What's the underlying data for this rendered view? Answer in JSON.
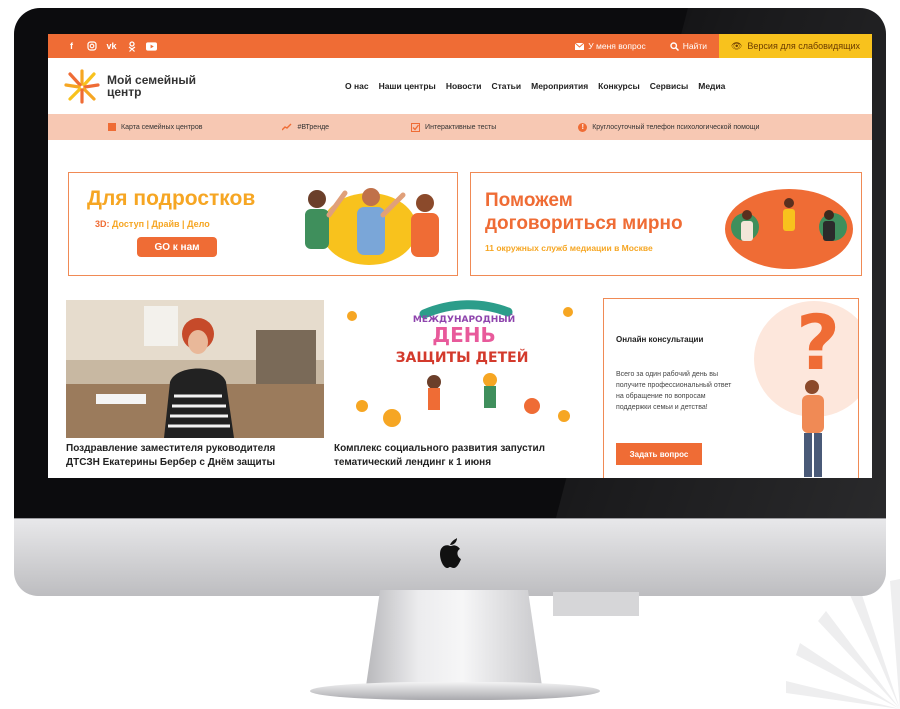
{
  "topbar": {
    "social_icons": [
      "facebook-icon",
      "instagram-icon",
      "vk-icon",
      "odnoklassniki-icon",
      "youtube-icon"
    ],
    "question_label": "У меня вопрос",
    "search_label": "Найти",
    "accessible_label": "Версия для слабовидящих"
  },
  "logo": {
    "line1": "Мой семейный",
    "line2": "центр"
  },
  "nav": {
    "items": [
      "О нас",
      "Наши центры",
      "Новости",
      "Статьи",
      "Мероприятия",
      "Конкурсы",
      "Сервисы",
      "Медиа"
    ]
  },
  "subbar": {
    "items": [
      {
        "label": "Карта семейных центров",
        "icon": "map-icon"
      },
      {
        "label": "#ВТренде",
        "icon": "trend-icon"
      },
      {
        "label": "Интерактивные тесты",
        "icon": "checkbox-icon"
      },
      {
        "label": "Круглосуточный телефон психологической помощи",
        "icon": "info-icon"
      }
    ]
  },
  "banner_teens": {
    "title": "Для подростков",
    "prefix": "3D:",
    "tags": [
      "Доступ",
      "Драйв",
      "Дело"
    ],
    "button": "GO к нам"
  },
  "banner_mediation": {
    "title_line1": "Поможем",
    "title_line2": "договориться мирно",
    "subtitle": "11 окружных служб медиации в Москве"
  },
  "news": [
    {
      "title_line1": "Поздравление заместителя руководителя",
      "title_line2": "ДТСЗН Екатерины Бербер с Днём защиты"
    },
    {
      "title_line1": "Комплекс социального развития запустил",
      "title_line2": "тематический лендинг к 1 июня"
    }
  ],
  "children_day_art": {
    "line1": "МЕЖДУНАРОДНЫЙ",
    "line2": "ДЕНЬ",
    "line3": "ЗАЩИТЫ ДЕТЕЙ"
  },
  "consult": {
    "title": "Онлайн консультации",
    "text": "Всего за один рабочий день вы получите профессиональный ответ на обращение по вопросам поддержки семьи и детства!",
    "button": "Задать вопрос"
  },
  "colors": {
    "brand_orange": "#ef6c35",
    "accent_yellow": "#f8c21d",
    "soft_peach": "#f7c8b3"
  }
}
